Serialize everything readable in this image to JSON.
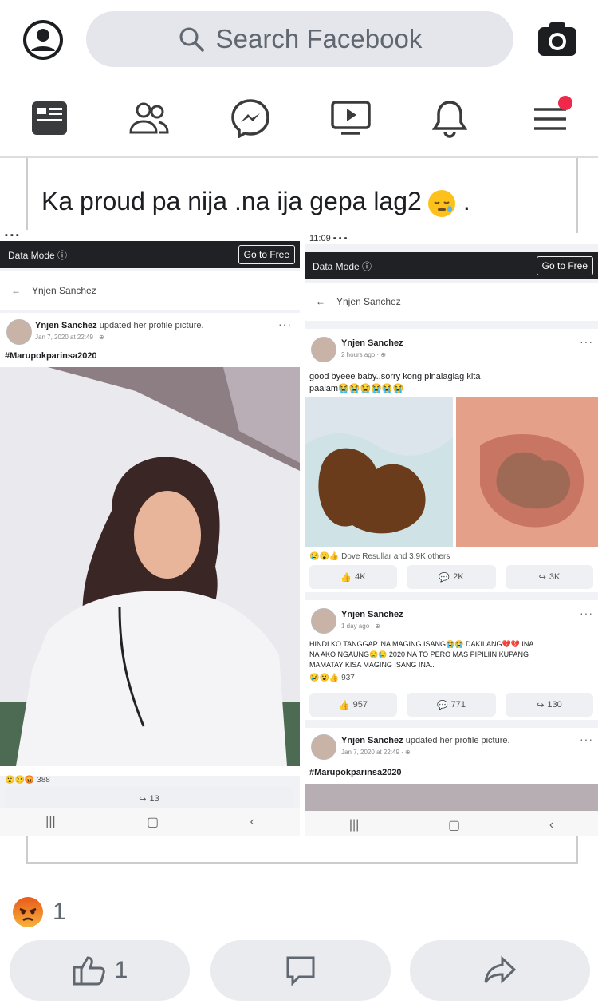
{
  "search": {
    "placeholder": "Search Facebook"
  },
  "nav": {
    "items": [
      "news-feed",
      "friends",
      "messenger",
      "watch",
      "notifications",
      "menu"
    ],
    "menu_badge_color": "#f02849"
  },
  "post": {
    "text": "Ka proud pa nija .na ija gepa lag2",
    "text_tail": ".",
    "reaction_count": "1",
    "like_count": "1"
  },
  "left_shot": {
    "status": "▪ ▪ ▪",
    "data_mode": "Data Mode ⓘ",
    "go_free": "Go to Free",
    "profile_name": "Ynjen Sanchez",
    "author": "Ynjen Sanchez",
    "action": "updated her profile picture.",
    "date": "Jan 7, 2020 at 22:49 · ⊕",
    "hashtag": "#Marupokparinsa2020",
    "reactions": "388",
    "shares": "13"
  },
  "right_shot": {
    "status": "11:09 ▪ ▪ ▪",
    "data_mode": "Data Mode ⓘ",
    "go_free": "Go to Free",
    "profile_name": "Ynjen Sanchez",
    "post1": {
      "author": "Ynjen Sanchez",
      "date": "2 hours ago · ⊕",
      "text_line1": "good byeee baby..sorry kong pinalaglag kita",
      "text_line2": "paalam😭😭😭😭😭😭",
      "reactions": "Dove Resullar and 3.9K others",
      "likes": "4K",
      "comments": "2K",
      "shares": "3K"
    },
    "post2": {
      "author": "Ynjen Sanchez",
      "date": "1 day ago · ⊕",
      "text_line1": "HINDI KO TANGGAP..NA MAGING ISANG😭😭 DAKILANG💔💔 INA..",
      "text_line2": "NA AKO NGAUNG😢😢 2020 NA TO PERO MAS PIPILIIN KUPANG",
      "text_line3": "MAMATAY KISA MAGING ISANG INA..",
      "reactions": "937",
      "likes": "957",
      "comments": "771",
      "shares": "130"
    },
    "post3": {
      "author": "Ynjen Sanchez",
      "action": "updated her profile picture.",
      "date": "Jan 7, 2020 at 22:49 · ⊕",
      "hashtag": "#Marupokparinsa2020"
    }
  }
}
